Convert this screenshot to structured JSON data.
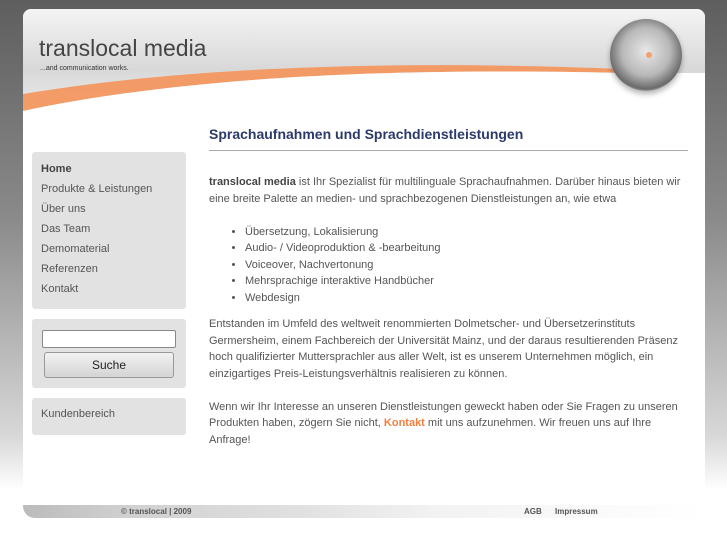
{
  "header": {
    "logo_title": "translocal media",
    "logo_tagline": "...and communication works."
  },
  "main": {
    "title": "Sprachaufnahmen und Sprachdienstleistungen",
    "intro_bold": "translocal media",
    "intro_rest": " ist Ihr Spezialist für multilinguale Sprachaufnahmen. Darüber hinaus bieten wir eine breite Palette an medien- und sprachbezogenen Dienstleistungen an, wie etwa",
    "services": [
      "Übersetzung, Lokalisierung",
      "Audio- / Videoproduktion & -bearbeitung",
      "Voiceover, Nachvertonung",
      "Mehrsprachige interaktive Handbücher",
      "Webdesign"
    ],
    "paragraph2": "Entstanden im Umfeld des weltweit renommierten Dolmetscher- und Übersetzerinstituts Germersheim, einem Fachbereich der Universität Mainz, und der daraus resultierenden Präsenz hoch qualifizierter Muttersprachler aus aller Welt, ist es unserem Unternehmen möglich, ein einzigartiges Preis-Leistungsverhältnis realisieren zu können.",
    "paragraph3_before": "Wenn wir Ihr Interesse an unseren Dienstleistungen geweckt haben oder Sie Fragen zu unseren Produkten haben, zögern Sie nicht, ",
    "paragraph3_link": "Kontakt",
    "paragraph3_after": " mit uns aufzunehmen. Wir freuen uns auf Ihre Anfrage!"
  },
  "sidebar": {
    "nav": [
      "Home",
      "Produkte & Leistungen",
      "Über uns",
      "Das Team",
      "Demomaterial",
      "Referenzen",
      "Kontakt"
    ],
    "search_value": "",
    "search_button": "Suche",
    "customer_area": "Kundenbereich"
  },
  "footer": {
    "copyright": "© translocal | 2009",
    "agb": "AGB",
    "impressum": "Impressum"
  },
  "colors": {
    "accent": "#f08040",
    "title": "#2b3a6b"
  }
}
